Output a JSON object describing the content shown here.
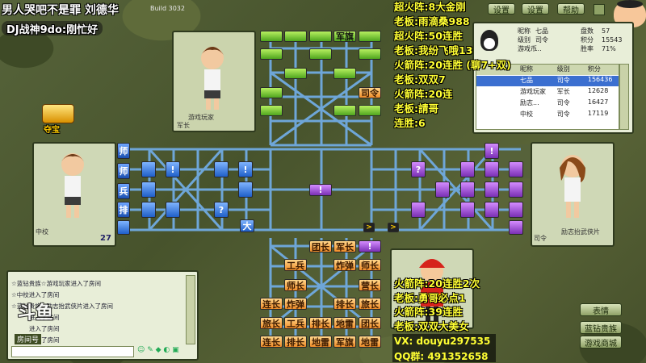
{
  "stream_overlay": {
    "title_line": "男人哭吧不是罪  刘德华",
    "dj_line": "DJ战神9do:刚忙好",
    "build": "Build 3032",
    "watermark_name": "斗鱼",
    "room_label": "房间号",
    "ads": [
      "超火阵:8大金刚",
      "老板:雨滴桑988",
      "超火阵:50连胜",
      "老板:我纷飞哦13",
      "火箭阵:20连胜 (聊7+双)",
      "老板:双双7",
      "火箭阵:20连",
      "老板:請哥",
      "连胜:6"
    ],
    "ads_bottom": [
      "火箭阵:20连胜2次",
      "老板:勇哥必点1",
      "火箭阵:39连胜",
      "老板:双双大美女"
    ],
    "contact_vx": "VX: douyu297535",
    "contact_qq": "QQ群: 491352658"
  },
  "toolbar": {
    "buttons": [
      "设置",
      "帮助",
      "设置"
    ]
  },
  "players": {
    "top": {
      "name": "游戏玩家",
      "rank": "军长"
    },
    "left": {
      "rank": "中校",
      "score": "27"
    },
    "right": {
      "name": "励志抬武侠片",
      "rank": "司令"
    },
    "chest_label": "夺宝"
  },
  "self_info": {
    "labels": [
      "昵称",
      "级别",
      "游戏币"
    ],
    "values": [
      "七品",
      "司令",
      "..."
    ],
    "stats_labels": [
      "盘数",
      "积分",
      "胜率"
    ],
    "stats_values": [
      "57",
      "15543",
      "71%"
    ]
  },
  "user_table": {
    "headers": [
      "昵称",
      "级别",
      "积分"
    ],
    "rows": [
      {
        "name": "七品",
        "level": "司令",
        "score": "156436"
      },
      {
        "name": "游戏玩家",
        "level": "军长",
        "score": "12628"
      },
      {
        "name": "励志...",
        "level": "司令",
        "score": "16427"
      },
      {
        "name": "中校",
        "level": "司令",
        "score": "17119"
      }
    ]
  },
  "chat": {
    "lines": [
      "☆蓝钻贵族☆游戏玩家进入了房间",
      "☆中校进入了房间",
      "☆蓝钻贵族☆励志抬武侠片进入了房间",
      "进入了房间",
      "进入了房间",
      "进入了房间"
    ]
  },
  "right_buttons": [
    "表情",
    "蓝钻贵族",
    "游戏商城"
  ],
  "board": {
    "bottom_pieces": [
      "团长",
      "军长",
      "工兵",
      "炸弹",
      "师长",
      "师长",
      "营长",
      "连长",
      "炸弹",
      "排长",
      "旅长",
      "旅长",
      "工兵",
      "排长",
      "地雷",
      "团长",
      "连长",
      "排长",
      "地雷",
      "军旗",
      "地雷"
    ],
    "top_piece": "军旗",
    "top_piece2": "司令",
    "left_pieces": [
      "师",
      "师",
      "兵",
      "排"
    ],
    "mid_piece": "大",
    "unknown_mark": "?",
    "bomb_mark": "!"
  },
  "colors": {
    "orange": "#f08c28",
    "green": "#4fa51e",
    "blue": "#1f5fc8",
    "purple": "#7a2fb4",
    "overlay_yellow": "#ffff33"
  }
}
